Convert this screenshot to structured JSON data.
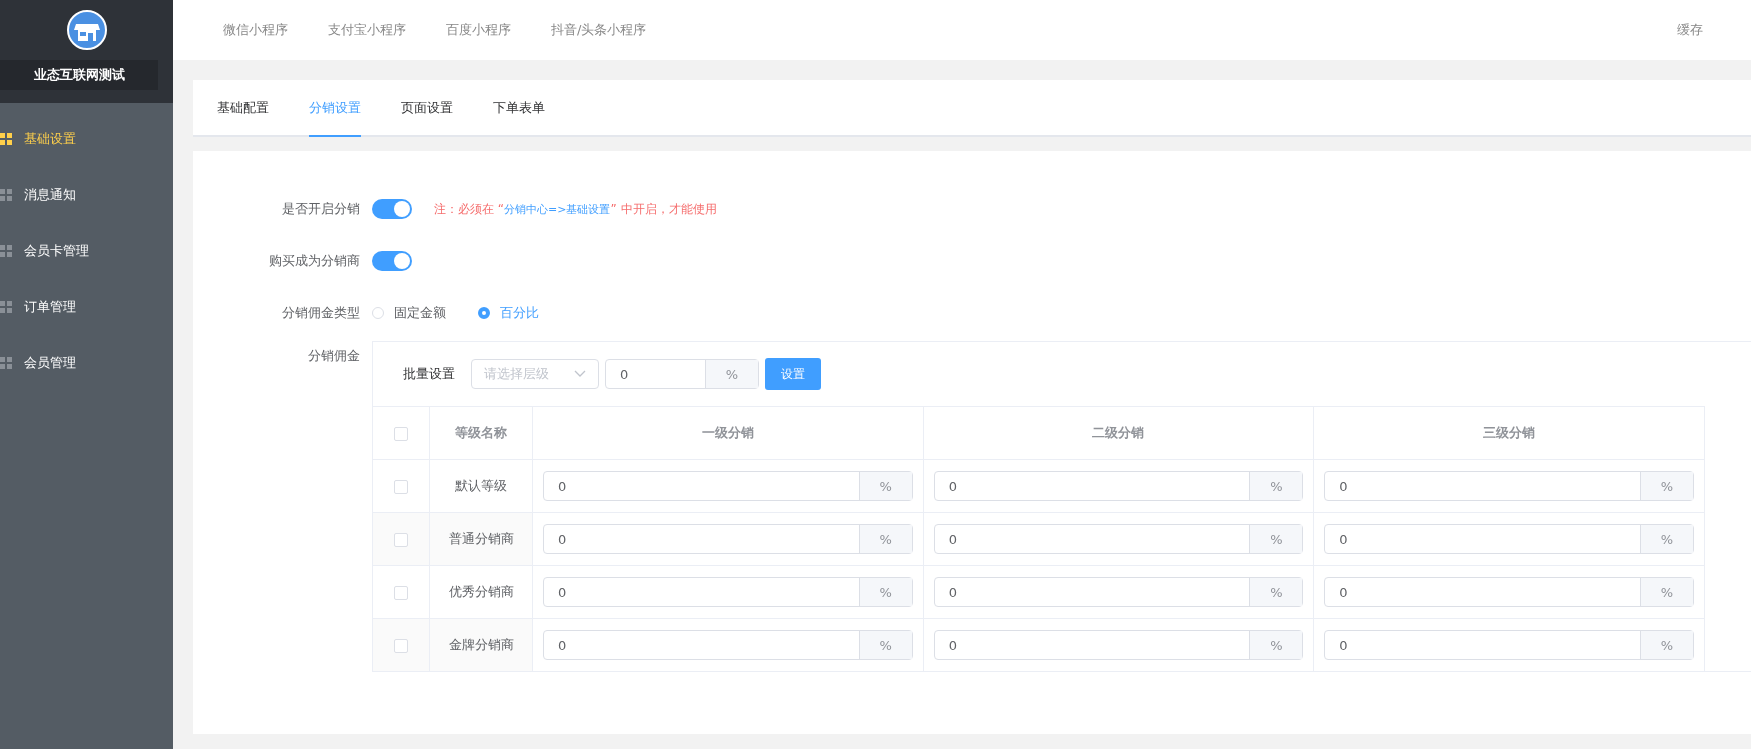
{
  "top_nav": {
    "items": [
      "微信小程序",
      "支付宝小程序",
      "百度小程序",
      "抖音/头条小程序"
    ],
    "right": "缓存"
  },
  "sidebar": {
    "shop_name": "业态互联网测试",
    "items": [
      {
        "label": "基础设置",
        "selected": true
      },
      {
        "label": "消息通知",
        "selected": false
      },
      {
        "label": "会员卡管理",
        "selected": false
      },
      {
        "label": "订单管理",
        "selected": false
      },
      {
        "label": "会员管理",
        "selected": false
      }
    ]
  },
  "tabs": [
    {
      "label": "基础配置",
      "selected": false
    },
    {
      "label": "分销设置",
      "selected": true
    },
    {
      "label": "页面设置",
      "selected": false
    },
    {
      "label": "下单表单",
      "selected": false
    }
  ],
  "form": {
    "distribution_switch": {
      "label": "是否开启分销",
      "on": true,
      "note": {
        "prefix": "注：必须在 “",
        "link": "分销中心=>基础设置",
        "suffix": "” 中开启，才能使用"
      }
    },
    "buy_switch": {
      "label": "购买成为分销商",
      "on": true
    },
    "commission_type": {
      "label": "分销佣金类型",
      "options": [
        {
          "label": "固定金额",
          "selected": false
        },
        {
          "label": "百分比",
          "selected": true
        }
      ]
    },
    "commission": {
      "label": "分销佣金",
      "batch": {
        "label": "批量设置",
        "select_placeholder": "请选择层级",
        "value": "0",
        "unit": "%",
        "button": "设置"
      },
      "table": {
        "columns": [
          {
            "kind": "checkbox",
            "checked": false
          },
          {
            "kind": "text",
            "label": "等级名称"
          },
          {
            "kind": "text",
            "label": "一级分销"
          },
          {
            "kind": "text",
            "label": "二级分销"
          },
          {
            "kind": "text",
            "label": "三级分销"
          }
        ],
        "rows": [
          {
            "cells": [
              {
                "kind": "checkbox",
                "checked": false
              },
              {
                "kind": "text",
                "value": "默认等级"
              },
              {
                "kind": "input",
                "value": "0",
                "unit": "%"
              },
              {
                "kind": "input",
                "value": "0",
                "unit": "%"
              },
              {
                "kind": "input",
                "value": "0",
                "unit": "%"
              }
            ]
          },
          {
            "cells": [
              {
                "kind": "checkbox",
                "checked": false
              },
              {
                "kind": "text",
                "value": "普通分销商"
              },
              {
                "kind": "input",
                "value": "0",
                "unit": "%"
              },
              {
                "kind": "input",
                "value": "0",
                "unit": "%"
              },
              {
                "kind": "input",
                "value": "0",
                "unit": "%"
              }
            ]
          },
          {
            "cells": [
              {
                "kind": "checkbox",
                "checked": false
              },
              {
                "kind": "text",
                "value": "优秀分销商"
              },
              {
                "kind": "input",
                "value": "0",
                "unit": "%"
              },
              {
                "kind": "input",
                "value": "0",
                "unit": "%"
              },
              {
                "kind": "input",
                "value": "0",
                "unit": "%"
              }
            ]
          },
          {
            "cells": [
              {
                "kind": "checkbox",
                "checked": false
              },
              {
                "kind": "text",
                "value": "金牌分销商"
              },
              {
                "kind": "input",
                "value": "0",
                "unit": "%"
              },
              {
                "kind": "input",
                "value": "0",
                "unit": "%"
              },
              {
                "kind": "input",
                "value": "0",
                "unit": "%"
              }
            ]
          }
        ]
      }
    }
  }
}
